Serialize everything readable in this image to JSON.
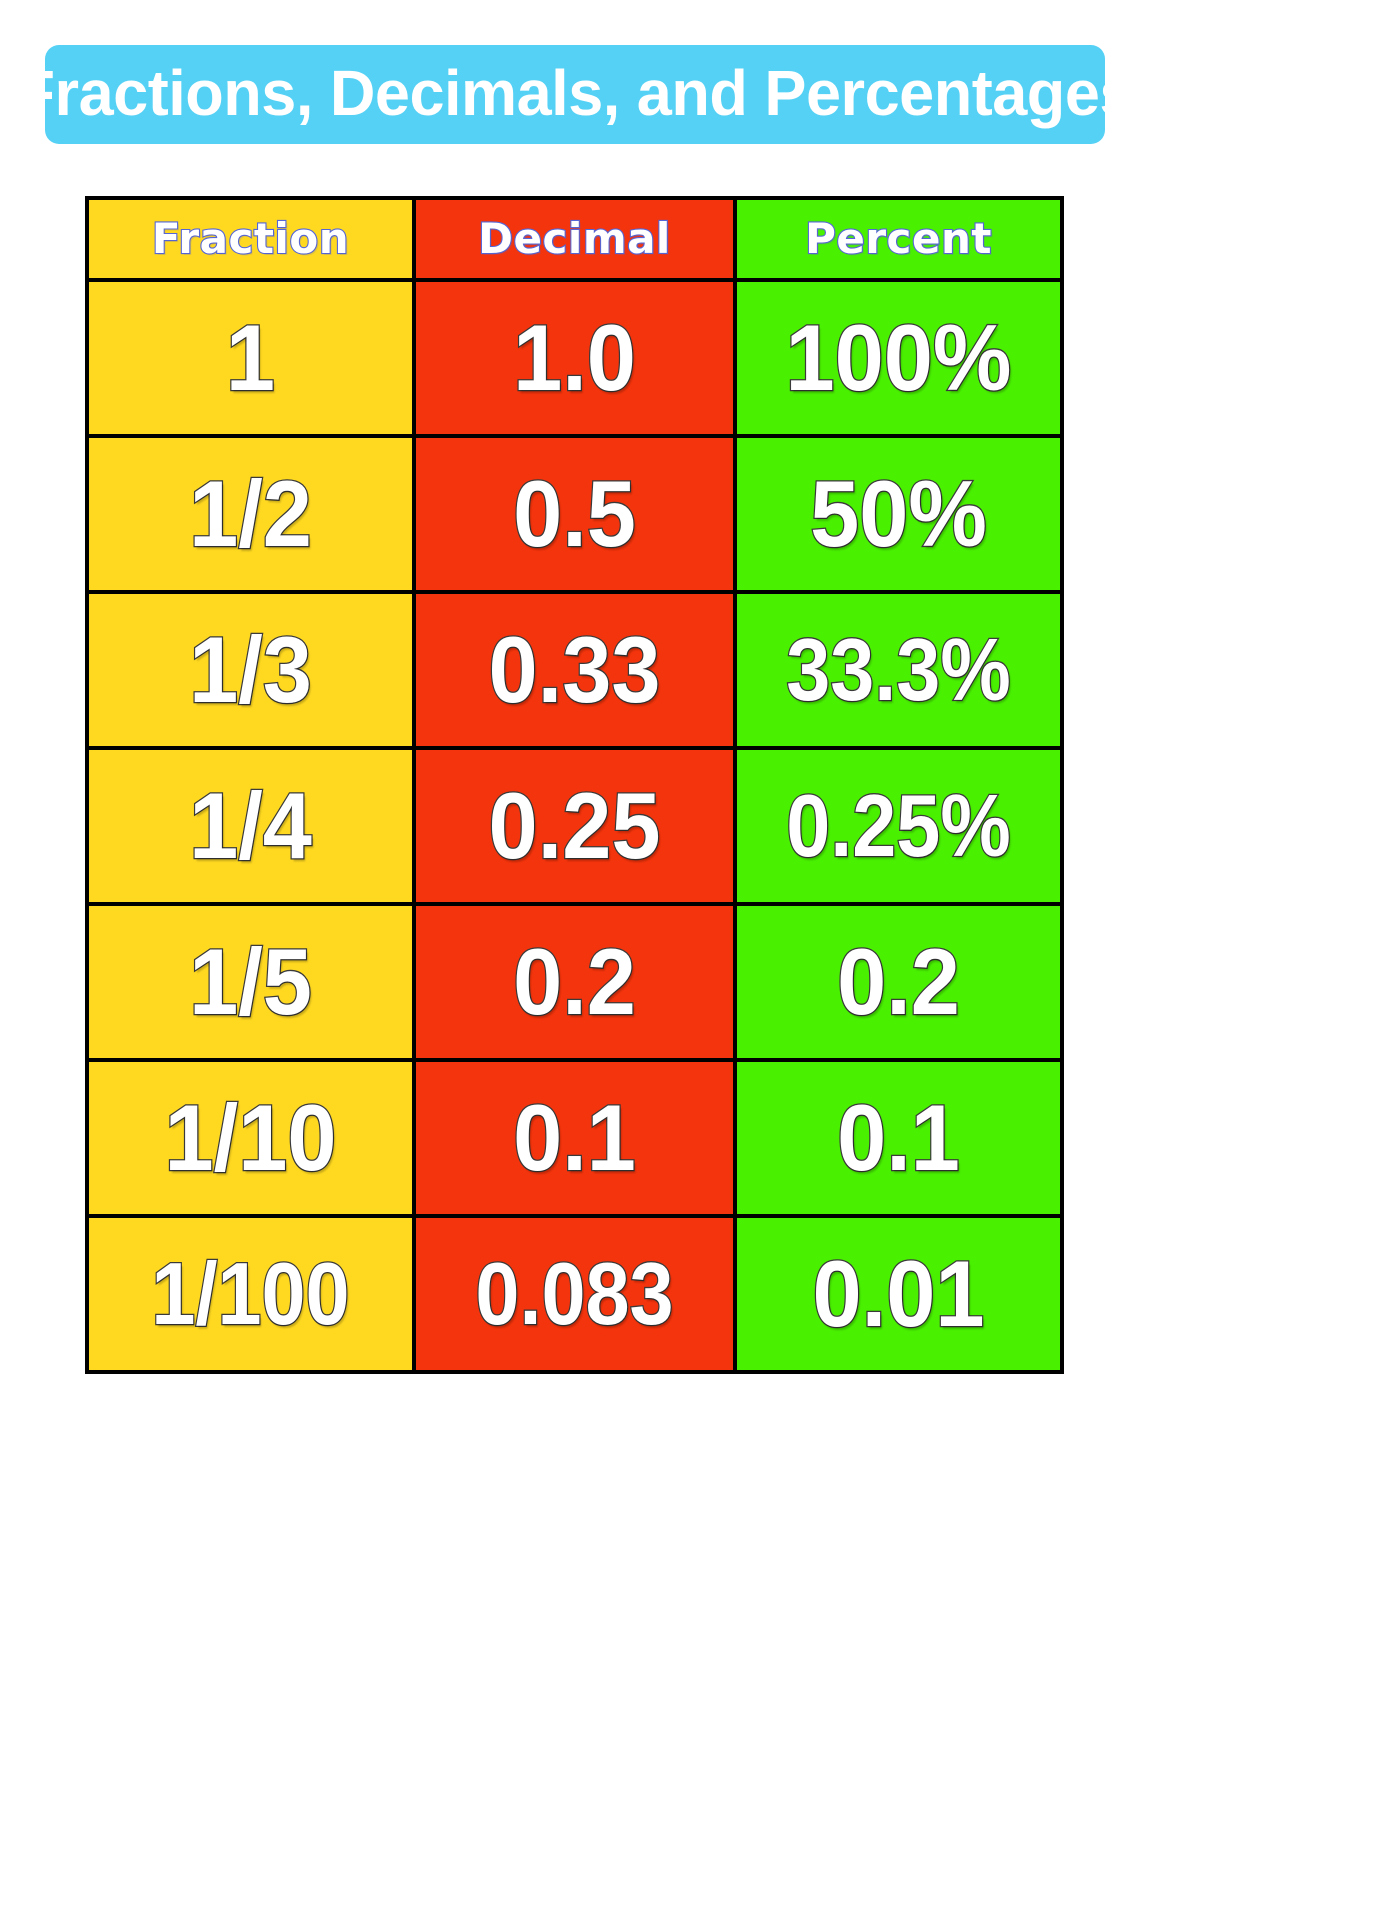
{
  "title": {
    "text": "Fractions, Decimals, and Percentages",
    "banner_color": "#55d1f5",
    "text_color": "#ffffff"
  },
  "table": {
    "columns": [
      {
        "key": "fraction",
        "header": "Fraction",
        "color": "#ffd920"
      },
      {
        "key": "decimal",
        "header": "Decimal",
        "color": "#f4340c"
      },
      {
        "key": "percent",
        "header": "Percent",
        "color": "#49f000"
      }
    ],
    "rows": [
      {
        "fraction": "1",
        "decimal": "1.0",
        "percent": "100%"
      },
      {
        "fraction": "1/2",
        "decimal": "0.5",
        "percent": "50%"
      },
      {
        "fraction": "1/3",
        "decimal": "0.33",
        "percent": "33.3%"
      },
      {
        "fraction": "1/4",
        "decimal": "0.25",
        "percent": "0.25%"
      },
      {
        "fraction": "1/5",
        "decimal": "0.2",
        "percent": "0.2"
      },
      {
        "fraction": "1/10",
        "decimal": "0.1",
        "percent": "0.1"
      },
      {
        "fraction": "1/100",
        "decimal": "0.083",
        "percent": "0.01"
      }
    ],
    "border_color": "#000000",
    "text_color": "#ffffff"
  }
}
